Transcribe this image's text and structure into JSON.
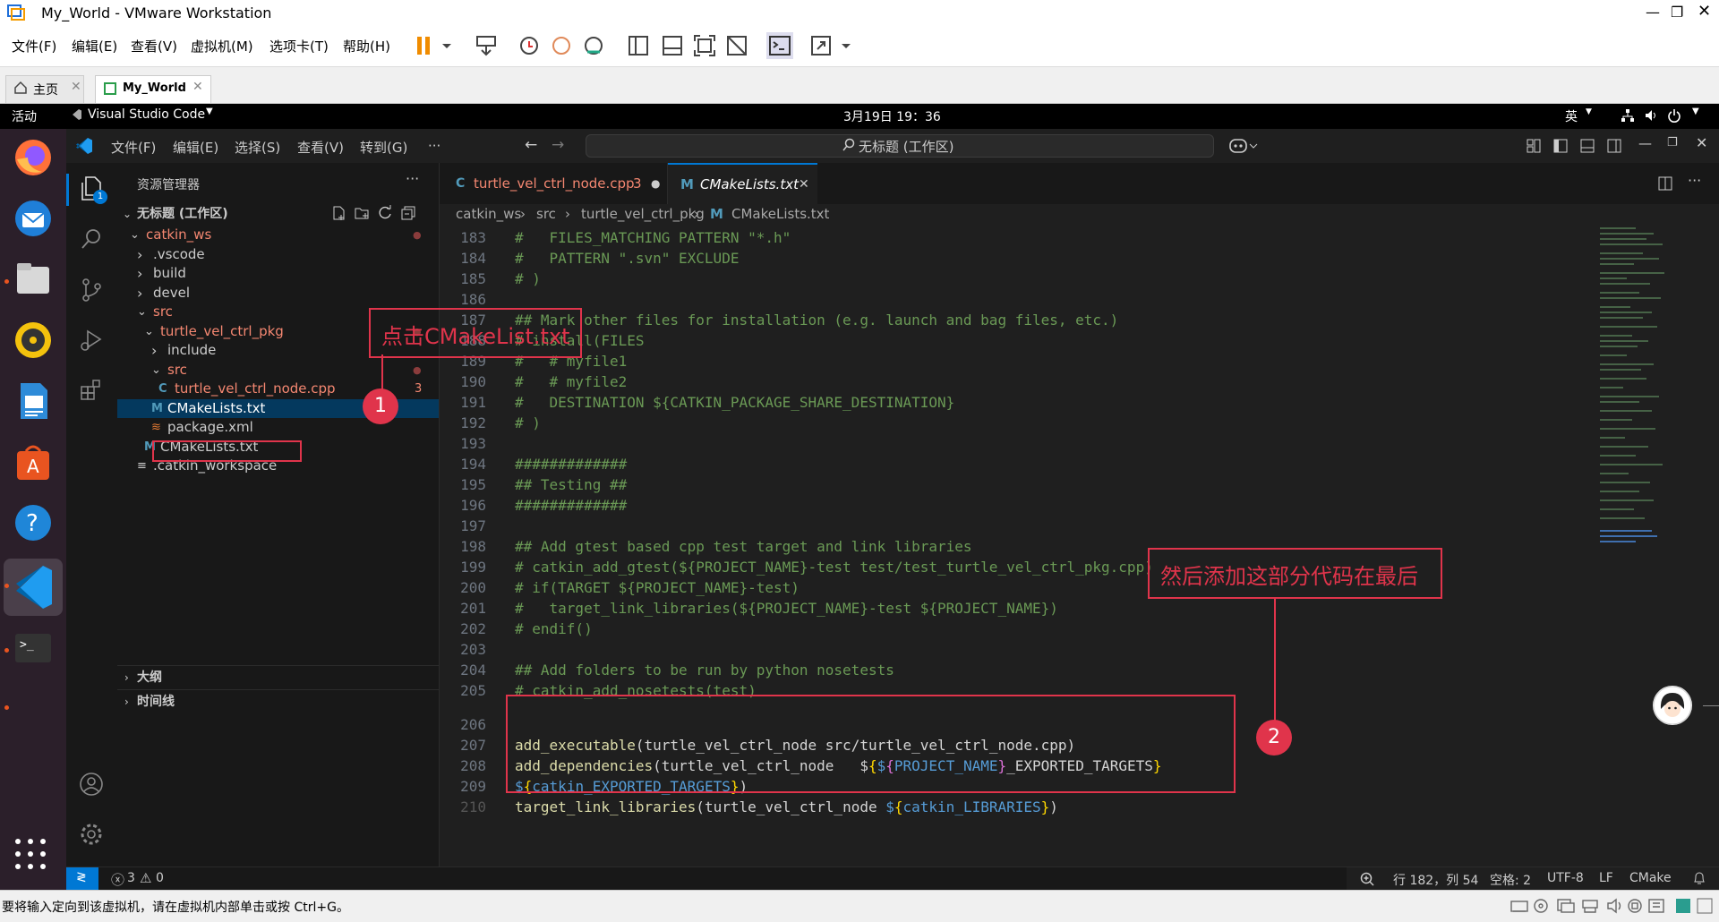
{
  "vmware": {
    "window_title": "My_World - VMware Workstation",
    "menu": [
      "文件(F)",
      "编辑(E)",
      "查看(V)",
      "虚拟机(M)",
      "选项卡(T)",
      "帮助(H)"
    ],
    "tabs": [
      {
        "label": "主页"
      },
      {
        "label": "My_World"
      }
    ],
    "status_text": "要将输入定向到该虚拟机，请在虚拟机内部单击或按 Ctrl+G。"
  },
  "ubuntu": {
    "activities": "活动",
    "app_name": "Visual Studio Code",
    "clock": "3月19日  19：36",
    "input_method": "英"
  },
  "vscode": {
    "menu": [
      "文件(F)",
      "编辑(E)",
      "选择(S)",
      "查看(V)",
      "转到(G)",
      "···"
    ],
    "command_center": "无标题 (工作区)",
    "explorer_title": "资源管理器",
    "explorer_badge": "1",
    "workspace_title": "无标题 (工作区)",
    "tree": [
      {
        "label": "catkin_ws",
        "indent": 1,
        "type": "folder-open",
        "color": "#f48771",
        "dot": true
      },
      {
        "label": ".vscode",
        "indent": 2,
        "type": "folder",
        "color": "#cccccc"
      },
      {
        "label": "build",
        "indent": 2,
        "type": "folder",
        "color": "#cccccc"
      },
      {
        "label": "devel",
        "indent": 2,
        "type": "folder",
        "color": "#cccccc"
      },
      {
        "label": "src",
        "indent": 2,
        "type": "folder-open",
        "color": "#f48771"
      },
      {
        "label": "turtle_vel_ctrl_pkg",
        "indent": 3,
        "type": "folder-open",
        "color": "#f48771",
        "dot": true
      },
      {
        "label": "include",
        "indent": 4,
        "type": "folder",
        "color": "#cccccc"
      },
      {
        "label": "src",
        "indent": 4,
        "type": "folder-open",
        "color": "#f48771",
        "dot": true
      },
      {
        "label": "turtle_vel_ctrl_node.cpp",
        "indent": 5,
        "type": "cpp",
        "color": "#f48771",
        "badge": "3"
      },
      {
        "label": "CMakeLists.txt",
        "indent": 4,
        "type": "cmake",
        "color": "#ffffff",
        "selected": true
      },
      {
        "label": "package.xml",
        "indent": 4,
        "type": "xml",
        "color": "#cccccc"
      },
      {
        "label": "CMakeLists.txt",
        "indent": 3,
        "type": "cmake",
        "color": "#cccccc"
      },
      {
        "label": ".catkin_workspace",
        "indent": 2,
        "type": "file",
        "color": "#cccccc"
      }
    ],
    "outline_label": "大纲",
    "timeline_label": "时间线",
    "editor_tabs": [
      {
        "label": "turtle_vel_ctrl_node.cpp",
        "badge": "3",
        "modified": true
      },
      {
        "label": "CMakeLists.txt",
        "active": true
      }
    ],
    "breadcrumb": [
      "catkin_ws",
      "src",
      "turtle_vel_ctrl_pkg",
      "CMakeLists.txt"
    ],
    "code_lines": [
      {
        "n": "183",
        "text": "#   FILES_MATCHING PATTERN \"*.h\""
      },
      {
        "n": "184",
        "text": "#   PATTERN \".svn\" EXCLUDE"
      },
      {
        "n": "185",
        "text": "# )"
      },
      {
        "n": "186",
        "text": ""
      },
      {
        "n": "187",
        "text": "## Mark other files for installation (e.g. launch and bag files, etc.)"
      },
      {
        "n": "188",
        "text": "# install(FILES"
      },
      {
        "n": "189",
        "text": "#   # myfile1"
      },
      {
        "n": "190",
        "text": "#   # myfile2"
      },
      {
        "n": "191",
        "text": "#   DESTINATION ${CATKIN_PACKAGE_SHARE_DESTINATION}"
      },
      {
        "n": "192",
        "text": "# )"
      },
      {
        "n": "193",
        "text": ""
      },
      {
        "n": "194",
        "text": "#############"
      },
      {
        "n": "195",
        "text": "## Testing ##"
      },
      {
        "n": "196",
        "text": "#############"
      },
      {
        "n": "197",
        "text": ""
      },
      {
        "n": "198",
        "text": "## Add gtest based cpp test target and link libraries"
      },
      {
        "n": "199",
        "text": "# catkin_add_gtest(${PROJECT_NAME}-test test/test_turtle_vel_ctrl_pkg.cpp)"
      },
      {
        "n": "200",
        "text": "# if(TARGET ${PROJECT_NAME}-test)"
      },
      {
        "n": "201",
        "text": "#   target_link_libraries(${PROJECT_NAME}-test ${PROJECT_NAME})"
      },
      {
        "n": "202",
        "text": "# endif()"
      },
      {
        "n": "203",
        "text": ""
      },
      {
        "n": "204",
        "text": "## Add folders to be run by python nosetests"
      },
      {
        "n": "205",
        "text": "# catkin_add_nosetests(test)"
      }
    ],
    "added_lines": {
      "l206": {
        "n": "206",
        "fn": "add_executable",
        "args": "turtle_vel_ctrl_node src/turtle_vel_ctrl_node.cpp"
      },
      "l207": {
        "n": "207",
        "fn": "add_dependencies",
        "args": "turtle_vel_ctrl_node   ",
        "var1": "PROJECT_NAME",
        "rest": "_EXPORTED_TARGETS"
      },
      "l208": {
        "n": "208",
        "var": "catkin_EXPORTED_TARGETS"
      },
      "l209": {
        "n": "209",
        "fn": "target_link_libraries",
        "args": "turtle_vel_ctrl_node ",
        "var": "catkin_LIBRARIES"
      },
      "l210": {
        "n": "210"
      }
    },
    "status": {
      "errors": "3",
      "warnings": "0",
      "position": "行 182，列 54",
      "spaces": "空格: 2",
      "encoding": "UTF-8",
      "eol": "LF",
      "language": "CMake"
    }
  },
  "annotations": {
    "a1_text": "点击CMakeList.txt",
    "a1_num": "1",
    "a2_text": "然后添加这部分代码在最后",
    "a2_num": "2",
    "color": "#e0344b"
  }
}
